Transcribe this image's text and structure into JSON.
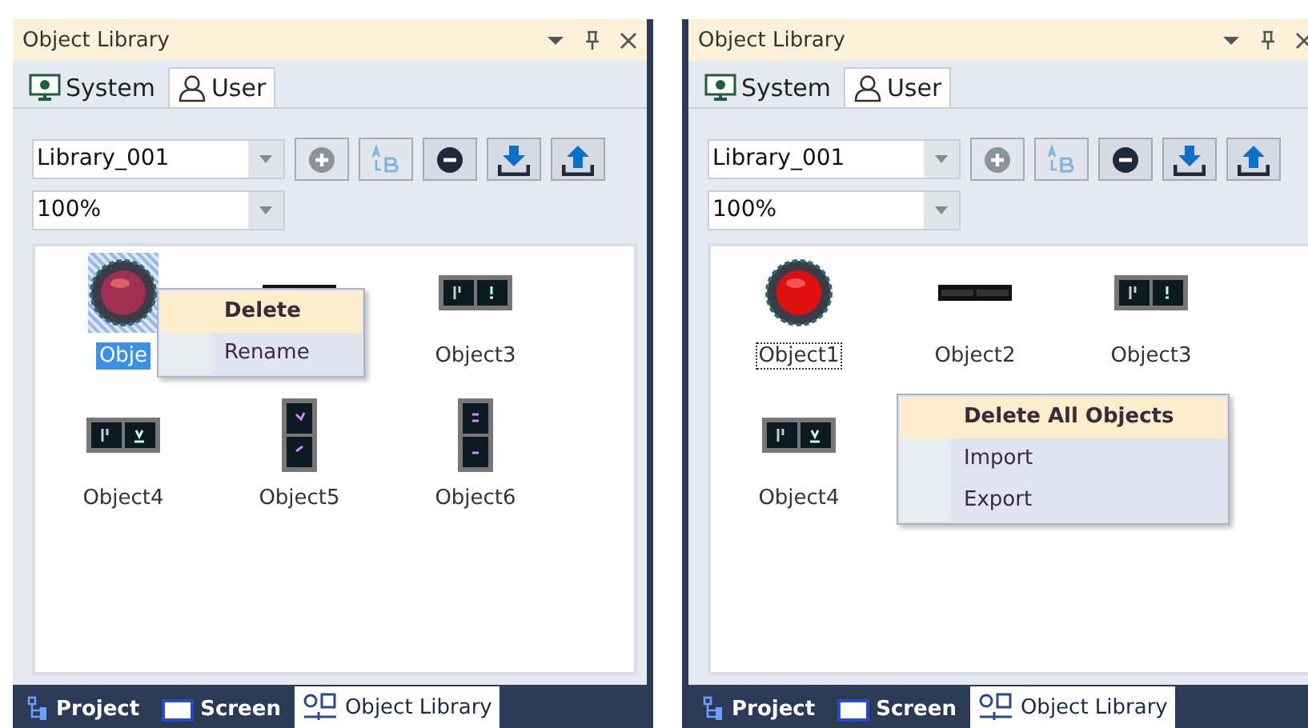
{
  "panels": [
    {
      "title": "Object Library",
      "tabs": [
        {
          "label": "System",
          "selected": false
        },
        {
          "label": "User",
          "selected": true
        }
      ],
      "library_select": {
        "value": "Library_001"
      },
      "zoom_select": {
        "value": "100%"
      },
      "toolbar": [
        {
          "disabled": true
        },
        {
          "disabled": true
        },
        {
          "disabled": false
        },
        {
          "disabled": false
        },
        {
          "disabled": false
        }
      ],
      "objects": [
        {
          "label": "Obje",
          "kind": "round",
          "selected": true
        },
        {
          "kind": "bar",
          "selected": false
        },
        {
          "label": "Object3",
          "kind": "switch-h",
          "selected": false
        },
        {
          "label": "Object4",
          "kind": "switch-h2",
          "selected": false
        },
        {
          "label": "Object5",
          "kind": "switch-v",
          "selected": false
        },
        {
          "label": "Object6",
          "kind": "switch-v2",
          "selected": false
        }
      ],
      "context_menu": {
        "items": [
          {
            "label": "Delete",
            "highlighted": true
          },
          {
            "label": "Rename",
            "highlighted": false
          }
        ]
      },
      "bottom_tabs": [
        {
          "label": "Project",
          "selected": false
        },
        {
          "label": "Screen",
          "selected": false
        },
        {
          "label": "Object Library",
          "selected": true
        }
      ]
    },
    {
      "title": "Object Library",
      "tabs": [
        {
          "label": "System",
          "selected": false
        },
        {
          "label": "User",
          "selected": true
        }
      ],
      "library_select": {
        "value": "Library_001"
      },
      "zoom_select": {
        "value": "100%"
      },
      "toolbar": [
        {
          "disabled": true
        },
        {
          "disabled": true
        },
        {
          "disabled": false
        },
        {
          "disabled": false
        },
        {
          "disabled": false
        }
      ],
      "objects": [
        {
          "label": "Object1",
          "kind": "round-red",
          "focused": true
        },
        {
          "label": "Object2",
          "kind": "bar",
          "focused": false
        },
        {
          "label": "Object3",
          "kind": "switch-h",
          "focused": false
        },
        {
          "label": "Object4",
          "kind": "switch-h2",
          "focused": false
        }
      ],
      "context_menu": {
        "items": [
          {
            "label": "Delete All Objects",
            "highlighted": true
          },
          {
            "label": "Import",
            "highlighted": false
          },
          {
            "label": "Export",
            "highlighted": false
          }
        ]
      },
      "bottom_tabs": [
        {
          "label": "Project",
          "selected": false
        },
        {
          "label": "Screen",
          "selected": false
        },
        {
          "label": "Object Library",
          "selected": true
        }
      ]
    }
  ]
}
